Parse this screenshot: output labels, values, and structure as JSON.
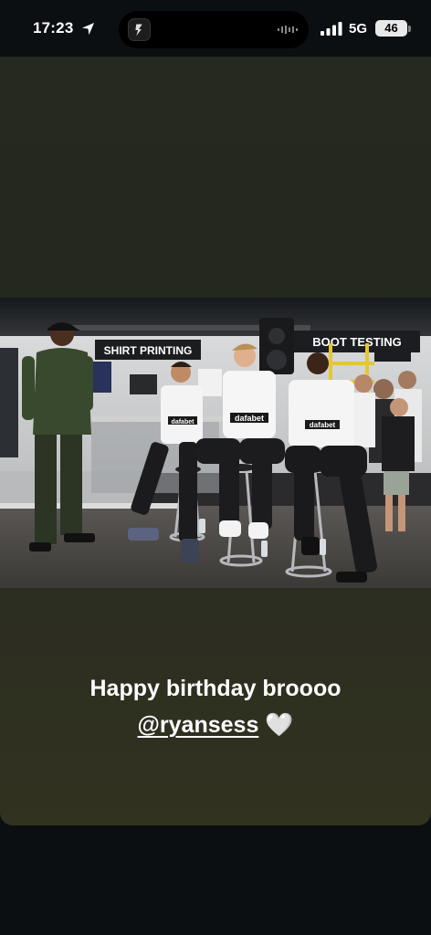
{
  "status_bar": {
    "time": "17:23",
    "network": "5G",
    "battery": "46"
  },
  "story": {
    "photo": {
      "signs": {
        "shirt_printing": "SHIRT PRINTING",
        "boot_testing": "BOOT TESTING"
      },
      "shirt_sponsor": "dafabet"
    },
    "caption": {
      "text": "Happy birthday broooo",
      "mention_symbol": "@",
      "mention": "ryansess",
      "emoji": "🤍"
    }
  },
  "colors": {
    "background": "#0c0f11",
    "card": "#27291f",
    "text": "#ffffff"
  }
}
